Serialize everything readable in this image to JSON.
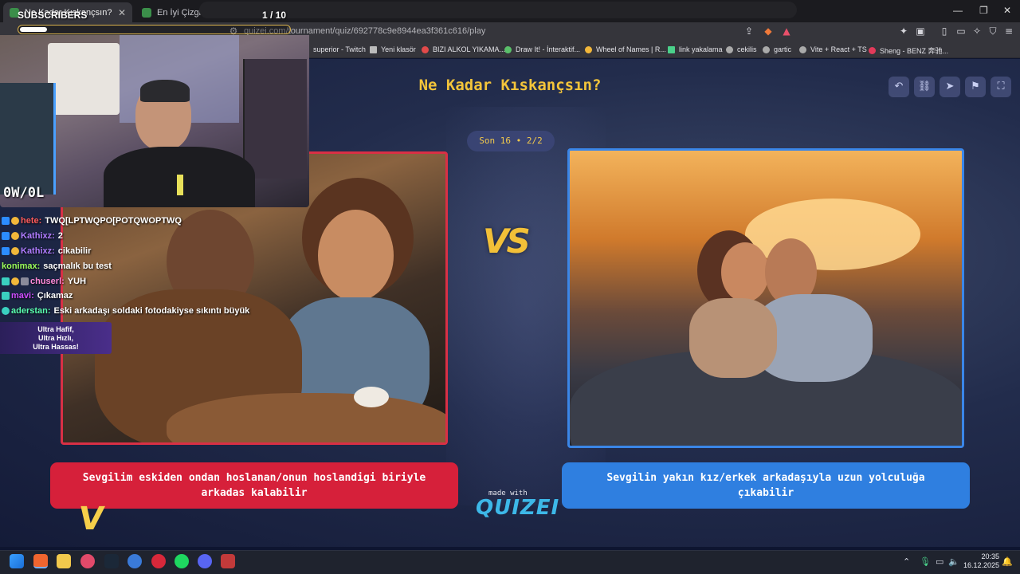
{
  "browser": {
    "tabs": [
      {
        "title": "Ne Kadar Kıskançsın? - Tier List",
        "active": true
      },
      {
        "title": "En İyi Çizgi Film Hangisi? - Tier List |",
        "active": false
      }
    ],
    "url": "quizei.com/tournament/quiz/692778c9e8944ea3f361c616/play",
    "bookmarks": [
      "superior - Twitch",
      "Yeni klasör",
      "BIZI ALKOL YIKAMA...",
      "Draw It! - İnteraktif...",
      "Wheel of Names | R...",
      "link yakalama",
      "cekilis",
      "gartic",
      "Vite + React + TS",
      "Sheng - BENZ 奔驰..."
    ]
  },
  "quiz": {
    "title": "Ne Kadar Kıskançsın?",
    "progress": "Son 16 • 2/2",
    "vs_label": "VS",
    "left_choice": "Sevgilim eskiden ondan hoslanan/onun hoslandigi biriyle arkadas kalabilir",
    "right_choice": "Sevgilin yakın kız/erkek arkadaşıyla uzun yolculuğa çıkabilir",
    "made_with": "made with",
    "brand": "QUIZEI"
  },
  "stream": {
    "subs_label": "SUBSCRIBERS",
    "subs_count": "1 / 10",
    "subs_progress": 0.1,
    "cam_tag": "0W/0L",
    "chat": [
      {
        "user": "hete:",
        "message": "TWQ[LPTWQPO[POTQWOPTWQ",
        "color": "#ff5a5a"
      },
      {
        "user": "Kathixz:",
        "message": "2",
        "color": "#b07cff"
      },
      {
        "user": "Kathixz:",
        "message": "cikabilir",
        "color": "#b07cff"
      },
      {
        "user": "konimax:",
        "message": "saçmalık bu test",
        "color": "#9cff5a"
      },
      {
        "user": "chuserl:",
        "message": "YUH",
        "color": "#ff8ad8"
      },
      {
        "user": "mavi:",
        "message": "Çıkamaz",
        "color": "#d04cff"
      },
      {
        "user": "aderstan:",
        "message": "Eski arkadaşı soldaki fotodakiyse sıkıntı büyük",
        "color": "#5affb0"
      }
    ],
    "ad_text": [
      "Ultra Hafif,",
      "Ultra Hızlı,",
      "Ultra Hassas!"
    ]
  },
  "taskbar": {
    "time": "20:35",
    "date": "16.12.2025"
  },
  "colors": {
    "accent_yellow": "#f3c43a",
    "left_red": "#d6203a",
    "right_blue": "#2f7fe0"
  }
}
